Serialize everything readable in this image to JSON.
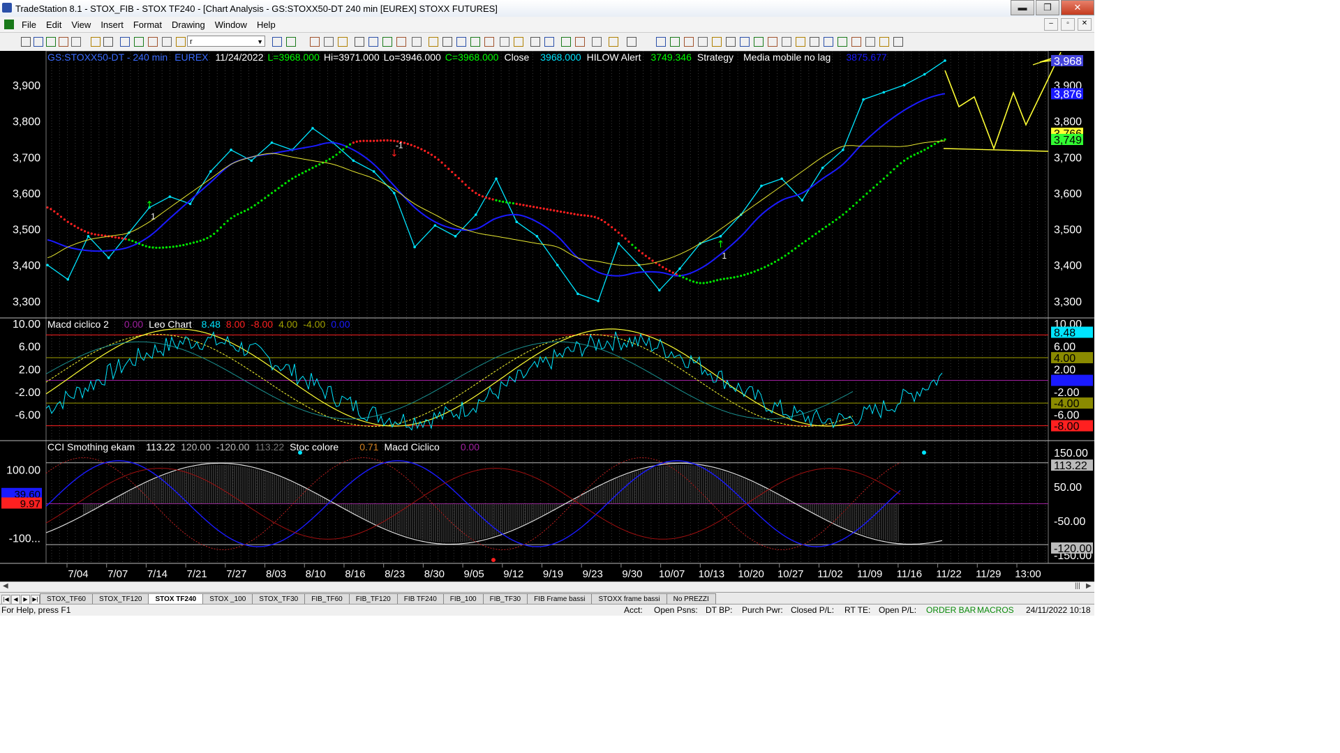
{
  "window": {
    "title": "TradeStation 8.1 - STOX_FIB - STOX TF240 - [Chart Analysis - GS:STOXX50-DT  240 min  [EUREX] STOXX FUTURES]",
    "min_glyph": "▬",
    "max_glyph": "❐",
    "close_glyph": "✕"
  },
  "menu": [
    "File",
    "Edit",
    "View",
    "Insert",
    "Format",
    "Drawing",
    "Window",
    "Help"
  ],
  "mdi": [
    "–",
    "▫",
    "✕"
  ],
  "toolbar": {
    "symbol_value": "r"
  },
  "colors": {
    "bg": "#000000",
    "up": "#00ff00",
    "down": "#ff2020",
    "price": "#00e5ff",
    "ma": "#1a1aff",
    "yellow": "#ffff33",
    "grid": "#4a4a4a"
  },
  "header": {
    "symbol": "GS:STOXX50-DT - 240 min",
    "exchange": "EUREX",
    "date": "11/24/2022",
    "low_open": "L=3968.000",
    "hi": "Hi=3971.000",
    "lo": "Lo=3946.000",
    "close_c": "C=3968.000",
    "close_label": "Close",
    "close_value": "3968.000",
    "hilow_label": "HILOW Alert",
    "hilow_value": "3749.346",
    "strategy_label": "Strategy",
    "mm_label": "Media mobile no lag",
    "mm_value": "3875.677"
  },
  "price_axis": {
    "ticks": [
      "3,900",
      "3,800",
      "3,700",
      "3,600",
      "3,500",
      "3,400",
      "3,300"
    ],
    "tick_values": [
      3900,
      3800,
      3700,
      3600,
      3500,
      3400,
      3300
    ],
    "range": [
      3255,
      3995
    ],
    "markers": [
      {
        "label": "3,968",
        "value": 3968,
        "color": "#4444dd",
        "text": "#ffffff"
      },
      {
        "label": "3,876",
        "value": 3876,
        "color": "#1a1aff",
        "text": "#ffffff"
      },
      {
        "label": "3,766",
        "value": 3766,
        "color": "#ffff33",
        "text": "#000000"
      },
      {
        "label": "3,749",
        "value": 3749,
        "color": "#33ff33",
        "text": "#000000"
      }
    ]
  },
  "signals": [
    {
      "label": "1",
      "dir": "up",
      "date_idx": 5,
      "value": 3570
    },
    {
      "label": "-1",
      "dir": "down",
      "date_idx": 17,
      "value": 3690
    },
    {
      "label": "1",
      "dir": "up",
      "date_idx": 33,
      "value": 3460
    }
  ],
  "macd_panel": {
    "header": {
      "name": "Macd ciclico 2",
      "v0": "0.00",
      "leo": "Leo Chart",
      "v1": "8.48",
      "v2": "8.00",
      "v3": "-8.00",
      "v4": "4.00",
      "v5": "-4.00",
      "v6": "0.00"
    },
    "ticks": [
      "10.00",
      "6.00",
      "2.00",
      "-2.00",
      "-6.00"
    ],
    "tick_values": [
      10,
      6,
      2,
      -2,
      -6
    ],
    "range": [
      -10.5,
      11
    ],
    "levels": [
      {
        "value": 8,
        "color": "#ff2020"
      },
      {
        "value": 4,
        "color": "#a0a000"
      },
      {
        "value": 0,
        "color": "#a020a0"
      },
      {
        "value": -4,
        "color": "#a0a000"
      },
      {
        "value": -8,
        "color": "#ff2020"
      }
    ],
    "markers": [
      {
        "label": "8.48",
        "value": 8.48,
        "color": "#00e5ff",
        "text": "#000000"
      },
      {
        "label": "4.00",
        "value": 4.0,
        "color": "#8a8a00",
        "text": "#000000"
      },
      {
        "label": "0.00",
        "value": 0.0,
        "color": "#1a1aff",
        "text": "#1a1aff"
      },
      {
        "label": "-4.00",
        "value": -4.0,
        "color": "#8a8a00",
        "text": "#000000"
      },
      {
        "label": "-8.00",
        "value": -8.0,
        "color": "#ff2020",
        "text": "#000000"
      }
    ]
  },
  "cci_panel": {
    "header": {
      "name": "CCI Smothing ekam",
      "v0": "113.22",
      "v1": "120.00",
      "v2": "-120.00",
      "v3": "113.22",
      "stoc": "Stoc colore",
      "v4": "0.71",
      "macd": "Macd Ciclico",
      "v5": "0.00"
    },
    "ticks_left": [
      "100.00",
      "-100..."
    ],
    "tick_left_values": [
      100,
      -100
    ],
    "ticks_right": [
      "150.00",
      "50.00",
      "-50.00",
      "-150.00"
    ],
    "tick_right_values": [
      150,
      50,
      -50,
      -150
    ],
    "range": [
      -175,
      185
    ],
    "levels": [
      {
        "value": 120,
        "color": "#bbbbbb"
      },
      {
        "value": 0,
        "color": "#a020a0"
      },
      {
        "value": -120,
        "color": "#bbbbbb"
      }
    ],
    "markers_right": [
      {
        "label": "113.22",
        "value": 113.22,
        "color": "#bbbbbb",
        "text": "#000000"
      },
      {
        "label": "-120.00",
        "value": -130,
        "color": "#bbbbbb",
        "text": "#000000"
      }
    ],
    "markers_left": [
      {
        "label": "39.60",
        "value": 30,
        "color": "#1a1aff",
        "text": "#000000"
      },
      {
        "label": "9.97",
        "value": 2,
        "color": "#ff2020",
        "text": "#000000"
      }
    ]
  },
  "date_axis": [
    "7/04",
    "7/07",
    "7/14",
    "7/21",
    "7/27",
    "8/03",
    "8/10",
    "8/16",
    "8/23",
    "8/30",
    "9/05",
    "9/12",
    "9/19",
    "9/23",
    "9/30",
    "10/07",
    "10/13",
    "10/20",
    "10/27",
    "11/02",
    "11/09",
    "11/16",
    "11/22",
    "11/29",
    "13:00"
  ],
  "chart_data": {
    "type": "line",
    "x": [
      "7/01",
      "7/04",
      "7/07",
      "7/11",
      "7/14",
      "7/18",
      "7/21",
      "7/25",
      "7/27",
      "8/01",
      "8/03",
      "8/05",
      "8/10",
      "8/12",
      "8/16",
      "8/18",
      "8/23",
      "8/25",
      "8/30",
      "9/01",
      "9/05",
      "9/07",
      "9/12",
      "9/14",
      "9/19",
      "9/21",
      "9/23",
      "9/27",
      "9/30",
      "10/04",
      "10/07",
      "10/11",
      "10/13",
      "10/17",
      "10/20",
      "10/24",
      "10/27",
      "10/31",
      "11/02",
      "11/07",
      "11/09",
      "11/14",
      "11/16",
      "11/21",
      "11/22"
    ],
    "series": [
      {
        "name": "Close",
        "values": [
          3400,
          3360,
          3480,
          3420,
          3490,
          3560,
          3590,
          3570,
          3660,
          3720,
          3690,
          3740,
          3720,
          3780,
          3740,
          3690,
          3660,
          3600,
          3450,
          3510,
          3480,
          3540,
          3640,
          3520,
          3480,
          3400,
          3320,
          3300,
          3460,
          3400,
          3330,
          3390,
          3460,
          3480,
          3540,
          3620,
          3640,
          3580,
          3670,
          3720,
          3860,
          3880,
          3900,
          3930,
          3968
        ]
      },
      {
        "name": "Media mobile no lag",
        "values": [
          3470,
          3450,
          3440,
          3440,
          3450,
          3480,
          3530,
          3580,
          3630,
          3680,
          3700,
          3710,
          3720,
          3730,
          3740,
          3720,
          3680,
          3620,
          3560,
          3520,
          3500,
          3500,
          3530,
          3540,
          3520,
          3480,
          3420,
          3380,
          3370,
          3380,
          3380,
          3370,
          3390,
          3430,
          3480,
          3540,
          3580,
          3600,
          3640,
          3680,
          3740,
          3790,
          3830,
          3860,
          3876
        ]
      },
      {
        "name": "HILOW Alert",
        "values": [
          3560,
          3520,
          3490,
          3480,
          3470,
          3450,
          3450,
          3460,
          3480,
          3530,
          3560,
          3600,
          3640,
          3670,
          3700,
          3740,
          3745,
          3745,
          3730,
          3700,
          3650,
          3600,
          3580,
          3570,
          3560,
          3550,
          3540,
          3530,
          3490,
          3440,
          3400,
          3370,
          3350,
          3360,
          3370,
          3390,
          3420,
          3460,
          3500,
          3540,
          3590,
          3640,
          3690,
          3720,
          3749
        ]
      },
      {
        "name": "Strategy",
        "values": [
          3420,
          3450,
          3470,
          3480,
          3490,
          3520,
          3560,
          3600,
          3640,
          3680,
          3700,
          3710,
          3700,
          3690,
          3680,
          3660,
          3640,
          3610,
          3570,
          3540,
          3510,
          3490,
          3480,
          3470,
          3460,
          3450,
          3420,
          3410,
          3400,
          3400,
          3410,
          3430,
          3460,
          3500,
          3540,
          3580,
          3620,
          3660,
          3700,
          3730,
          3730,
          3730,
          3730,
          3740,
          3745
        ]
      }
    ],
    "ylim": [
      3255,
      3995
    ],
    "grid": true
  }
}
